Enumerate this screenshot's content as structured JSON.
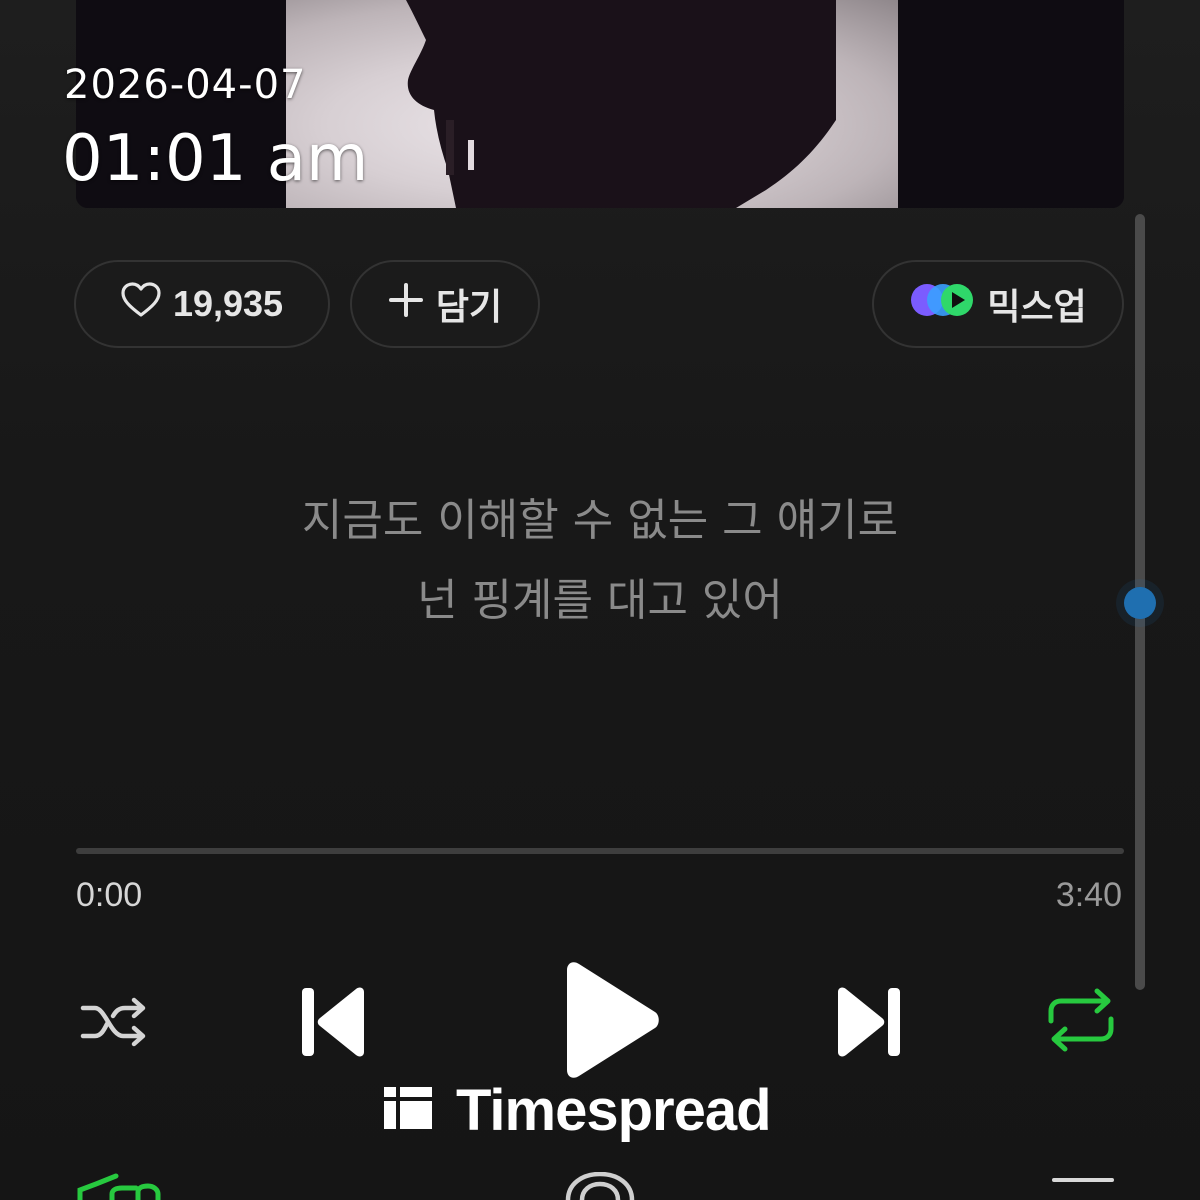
{
  "overlay": {
    "date": "2026-04-07",
    "time": "01:01 am"
  },
  "actions": {
    "like_count": "19,935",
    "add_label": "담기",
    "mixup_label": "믹스업"
  },
  "lyrics": {
    "line1": "지금도 이해할 수 없는 그 얘기로",
    "line2": "넌 핑계를 대고 있어"
  },
  "playback": {
    "elapsed": "0:00",
    "total": "3:40",
    "progress_fraction": 0.0,
    "is_playing": false,
    "repeat_on": true
  },
  "icons": {
    "like": "heart-icon",
    "add": "plus-icon",
    "mixup": "mixup-logo-icon",
    "shuffle": "shuffle-icon",
    "previous": "skip-previous-icon",
    "play": "play-icon",
    "next": "skip-next-icon",
    "repeat": "repeat-icon"
  },
  "colors": {
    "accent_green": "#27c93f",
    "scroll_thumb": "#1f6fb0",
    "mixup_purple": "#7b5cff",
    "mixup_blue": "#3aa0ff",
    "mixup_green": "#2fd86a"
  },
  "watermark": {
    "text": "Timespread"
  }
}
